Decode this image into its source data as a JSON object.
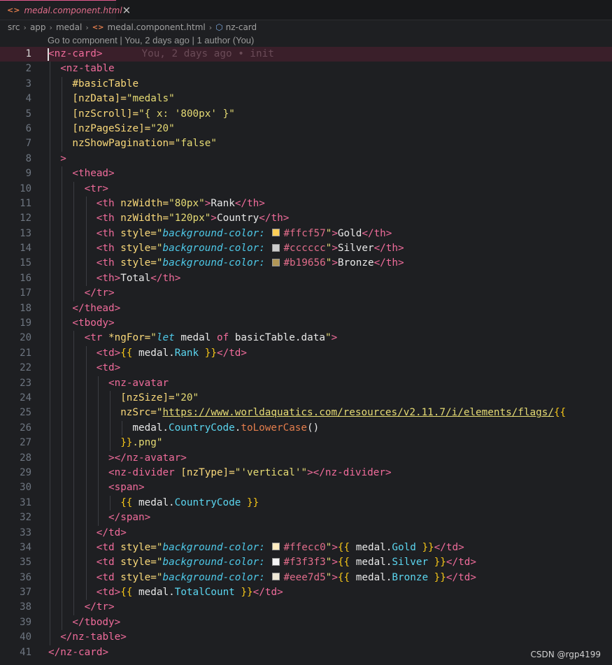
{
  "tab": {
    "icon": "html-file-icon",
    "label": "medal.component.html",
    "close_glyph": "✕"
  },
  "breadcrumb": [
    "src",
    "app",
    "medal",
    "medal.component.html",
    "nz-card"
  ],
  "codelens": "Go to component | You, 2 days ago | 1 author (You)",
  "blame": "You, 2 days ago • init",
  "colors": {
    "gold": "#ffcf57",
    "silver": "#cccccc",
    "bronze": "#b19656",
    "gold_td": "#ffecc0",
    "silver_td": "#f3f3f3",
    "bronze_td": "#eee7d5"
  },
  "lines": [
    [
      [
        "<",
        "tg"
      ],
      [
        "nz-card",
        "tg"
      ],
      [
        ">",
        "tg"
      ]
    ],
    [
      [
        "<nz-table",
        "tg"
      ]
    ],
    [
      [
        "#basicTable",
        "at"
      ]
    ],
    [
      [
        "[nzData]=",
        "at"
      ],
      [
        "\"medals\"",
        "str"
      ]
    ],
    [
      [
        "[nzScroll]=",
        "at"
      ],
      [
        "\"{ x: '800px' }\"",
        "str"
      ]
    ],
    [
      [
        "[nzPageSize]=",
        "at"
      ],
      [
        "\"20\"",
        "str"
      ]
    ],
    [
      [
        "nzShowPagination=",
        "at"
      ],
      [
        "\"false\"",
        "str"
      ]
    ],
    [
      [
        ">",
        "tg"
      ]
    ],
    [
      [
        "<",
        "tg"
      ],
      [
        "thead",
        "tg"
      ],
      [
        ">",
        "tg"
      ]
    ],
    [
      [
        "<",
        "tg"
      ],
      [
        "tr",
        "tg"
      ],
      [
        ">",
        "tg"
      ]
    ],
    [
      [
        "<th ",
        "tg"
      ],
      [
        "nzWidth=",
        "at"
      ],
      [
        "\"80px\"",
        "str"
      ],
      [
        ">",
        "tg"
      ],
      [
        "Rank",
        "pl"
      ],
      [
        "</",
        "tg"
      ],
      [
        "th",
        "tg"
      ],
      [
        ">",
        "tg"
      ]
    ],
    [
      [
        "<th ",
        "tg"
      ],
      [
        "nzWidth=",
        "at"
      ],
      [
        "\"120px\"",
        "str"
      ],
      [
        ">",
        "tg"
      ],
      [
        "Country",
        "pl"
      ],
      [
        "</",
        "tg"
      ],
      [
        "th",
        "tg"
      ],
      [
        ">",
        "tg"
      ]
    ],
    [
      [
        "<th ",
        "tg"
      ],
      [
        "style=",
        "at"
      ],
      [
        "\"",
        "str"
      ],
      [
        "background-color:",
        "sty"
      ],
      [
        " ",
        "pl"
      ],
      [
        "#ffcf57",
        "swatch"
      ],
      [
        "#ffcf57",
        "hex"
      ],
      [
        "\"",
        "str"
      ],
      [
        ">",
        "tg"
      ],
      [
        "Gold",
        "pl"
      ],
      [
        "</",
        "tg"
      ],
      [
        "th",
        "tg"
      ],
      [
        ">",
        "tg"
      ]
    ],
    [
      [
        "<th ",
        "tg"
      ],
      [
        "style=",
        "at"
      ],
      [
        "\"",
        "str"
      ],
      [
        "background-color:",
        "sty"
      ],
      [
        " ",
        "pl"
      ],
      [
        "#cccccc",
        "swatch"
      ],
      [
        "#cccccc",
        "hex"
      ],
      [
        "\"",
        "str"
      ],
      [
        ">",
        "tg"
      ],
      [
        "Silver",
        "pl"
      ],
      [
        "</",
        "tg"
      ],
      [
        "th",
        "tg"
      ],
      [
        ">",
        "tg"
      ]
    ],
    [
      [
        "<th ",
        "tg"
      ],
      [
        "style=",
        "at"
      ],
      [
        "\"",
        "str"
      ],
      [
        "background-color:",
        "sty"
      ],
      [
        " ",
        "pl"
      ],
      [
        "#b19656",
        "swatch"
      ],
      [
        "#b19656",
        "hex"
      ],
      [
        "\"",
        "str"
      ],
      [
        ">",
        "tg"
      ],
      [
        "Bronze",
        "pl"
      ],
      [
        "</",
        "tg"
      ],
      [
        "th",
        "tg"
      ],
      [
        ">",
        "tg"
      ]
    ],
    [
      [
        "<th>",
        "tg"
      ],
      [
        "Total",
        "pl"
      ],
      [
        "</",
        "tg"
      ],
      [
        "th",
        "tg"
      ],
      [
        ">",
        "tg"
      ]
    ],
    [
      [
        "</",
        "tg"
      ],
      [
        "tr",
        "tg"
      ],
      [
        ">",
        "tg"
      ]
    ],
    [
      [
        "</",
        "tg"
      ],
      [
        "thead",
        "tg"
      ],
      [
        ">",
        "tg"
      ]
    ],
    [
      [
        "<",
        "tg"
      ],
      [
        "tbody",
        "tg"
      ],
      [
        ">",
        "tg"
      ]
    ],
    [
      [
        "<tr ",
        "tg"
      ],
      [
        "*ngFor=",
        "at"
      ],
      [
        "\"",
        "str"
      ],
      [
        "let",
        "kwi"
      ],
      [
        " medal ",
        "pl"
      ],
      [
        "of",
        "kw"
      ],
      [
        " basicTable.data",
        "pl"
      ],
      [
        "\"",
        "str"
      ],
      [
        ">",
        "tg"
      ]
    ],
    [
      [
        "<td>",
        "tg"
      ],
      [
        "{{",
        "br"
      ],
      [
        " medal.",
        "pl"
      ],
      [
        "Rank",
        "mem"
      ],
      [
        " ",
        "pl"
      ],
      [
        "}}",
        "br"
      ],
      [
        "</",
        "tg"
      ],
      [
        "td",
        "tg"
      ],
      [
        ">",
        "tg"
      ]
    ],
    [
      [
        "<td>",
        "tg"
      ]
    ],
    [
      [
        "<",
        "tg"
      ],
      [
        "nz-avatar",
        "tg"
      ]
    ],
    [
      [
        "[nzSize]=",
        "at"
      ],
      [
        "\"20\"",
        "str"
      ]
    ],
    [
      [
        "nzSrc=",
        "at"
      ],
      [
        "\"",
        "str"
      ],
      [
        "https://www.worldaquatics.com/resources/v2.11.7/i/elements/flags/",
        "url"
      ],
      [
        "{{",
        "br"
      ]
    ],
    [
      [
        "medal.",
        "pl"
      ],
      [
        "CountryCode",
        "mem"
      ],
      [
        ".",
        "pl"
      ],
      [
        "toLowerCase",
        "fn"
      ],
      [
        "()",
        "pl"
      ]
    ],
    [
      [
        "}}",
        "br"
      ],
      [
        ".png\"",
        "str"
      ]
    ],
    [
      [
        "></",
        "tg"
      ],
      [
        "nz-avatar",
        "tg"
      ],
      [
        ">",
        "tg"
      ]
    ],
    [
      [
        "<nz-divider ",
        "tg"
      ],
      [
        "[nzType]=",
        "at"
      ],
      [
        "\"'vertical'\"",
        "str"
      ],
      [
        "></",
        "tg"
      ],
      [
        "nz-divider",
        "tg"
      ],
      [
        ">",
        "tg"
      ]
    ],
    [
      [
        "<",
        "tg"
      ],
      [
        "span",
        "tg"
      ],
      [
        ">",
        "tg"
      ]
    ],
    [
      [
        "{{",
        "br"
      ],
      [
        " medal.",
        "pl"
      ],
      [
        "CountryCode",
        "mem"
      ],
      [
        " ",
        "pl"
      ],
      [
        "}}",
        "br"
      ]
    ],
    [
      [
        "</",
        "tg"
      ],
      [
        "span",
        "tg"
      ],
      [
        ">",
        "tg"
      ]
    ],
    [
      [
        "</",
        "tg"
      ],
      [
        "td",
        "tg"
      ],
      [
        ">",
        "tg"
      ]
    ],
    [
      [
        "<td ",
        "tg"
      ],
      [
        "style=",
        "at"
      ],
      [
        "\"",
        "str"
      ],
      [
        "background-color:",
        "sty"
      ],
      [
        " ",
        "pl"
      ],
      [
        "#ffecc0",
        "swatch"
      ],
      [
        "#ffecc0",
        "hex"
      ],
      [
        "\"",
        "str"
      ],
      [
        ">",
        "tg"
      ],
      [
        "{{",
        "br"
      ],
      [
        " medal.",
        "pl"
      ],
      [
        "Gold",
        "mem"
      ],
      [
        " ",
        "pl"
      ],
      [
        "}}",
        "br"
      ],
      [
        "</",
        "tg"
      ],
      [
        "td",
        "tg"
      ],
      [
        ">",
        "tg"
      ]
    ],
    [
      [
        "<td ",
        "tg"
      ],
      [
        "style=",
        "at"
      ],
      [
        "\"",
        "str"
      ],
      [
        "background-color:",
        "sty"
      ],
      [
        " ",
        "pl"
      ],
      [
        "#f3f3f3",
        "swatch"
      ],
      [
        "#f3f3f3",
        "hex"
      ],
      [
        "\"",
        "str"
      ],
      [
        ">",
        "tg"
      ],
      [
        "{{",
        "br"
      ],
      [
        " medal.",
        "pl"
      ],
      [
        "Silver",
        "mem"
      ],
      [
        " ",
        "pl"
      ],
      [
        "}}",
        "br"
      ],
      [
        "</",
        "tg"
      ],
      [
        "td",
        "tg"
      ],
      [
        ">",
        "tg"
      ]
    ],
    [
      [
        "<td ",
        "tg"
      ],
      [
        "style=",
        "at"
      ],
      [
        "\"",
        "str"
      ],
      [
        "background-color:",
        "sty"
      ],
      [
        " ",
        "pl"
      ],
      [
        "#eee7d5",
        "swatch"
      ],
      [
        "#eee7d5",
        "hex"
      ],
      [
        "\"",
        "str"
      ],
      [
        ">",
        "tg"
      ],
      [
        "{{",
        "br"
      ],
      [
        " medal.",
        "pl"
      ],
      [
        "Bronze",
        "mem"
      ],
      [
        " ",
        "pl"
      ],
      [
        "}}",
        "br"
      ],
      [
        "</",
        "tg"
      ],
      [
        "td",
        "tg"
      ],
      [
        ">",
        "tg"
      ]
    ],
    [
      [
        "<td>",
        "tg"
      ],
      [
        "{{",
        "br"
      ],
      [
        " medal.",
        "pl"
      ],
      [
        "TotalCount",
        "mem"
      ],
      [
        " ",
        "pl"
      ],
      [
        "}}",
        "br"
      ],
      [
        "</",
        "tg"
      ],
      [
        "td",
        "tg"
      ],
      [
        ">",
        "tg"
      ]
    ],
    [
      [
        "</",
        "tg"
      ],
      [
        "tr",
        "tg"
      ],
      [
        ">",
        "tg"
      ]
    ],
    [
      [
        "</",
        "tg"
      ],
      [
        "tbody",
        "tg"
      ],
      [
        ">",
        "tg"
      ]
    ],
    [
      [
        "</",
        "tg"
      ],
      [
        "nz-table",
        "tg"
      ],
      [
        ">",
        "tg"
      ]
    ],
    [
      [
        "</",
        "tg"
      ],
      [
        "nz-card",
        "tg"
      ],
      [
        ">",
        "tg"
      ]
    ]
  ],
  "watermark": "CSDN @rgp4199"
}
